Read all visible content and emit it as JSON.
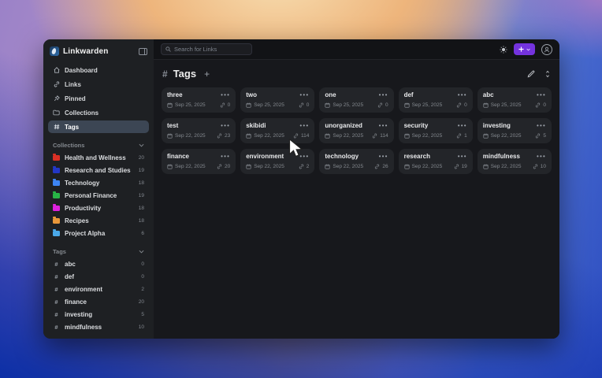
{
  "app": {
    "title": "Linkwarden"
  },
  "topbar": {
    "search_placeholder": "Search for Links"
  },
  "sidebar": {
    "nav": [
      {
        "label": "Dashboard"
      },
      {
        "label": "Links"
      },
      {
        "label": "Pinned"
      },
      {
        "label": "Collections"
      },
      {
        "label": "Tags"
      }
    ],
    "collections_header": "Collections",
    "collections": [
      {
        "label": "Health and Wellness",
        "count": "20",
        "color": "#d93025"
      },
      {
        "label": "Research and Studies",
        "count": "19",
        "color": "#2337c6"
      },
      {
        "label": "Technology",
        "count": "18",
        "color": "#3d85f4"
      },
      {
        "label": "Personal Finance",
        "count": "19",
        "color": "#28b446"
      },
      {
        "label": "Productivity",
        "count": "18",
        "color": "#de21de"
      },
      {
        "label": "Recipes",
        "count": "18",
        "color": "#e8973a"
      },
      {
        "label": "Project Alpha",
        "count": "6",
        "color": "#4aa8e8"
      }
    ],
    "tags_header": "Tags",
    "tags": [
      {
        "label": "abc",
        "count": "0"
      },
      {
        "label": "def",
        "count": "0"
      },
      {
        "label": "environment",
        "count": "2"
      },
      {
        "label": "finance",
        "count": "20"
      },
      {
        "label": "investing",
        "count": "5"
      },
      {
        "label": "mindfulness",
        "count": "10"
      }
    ]
  },
  "page": {
    "title": "Tags",
    "cards": [
      {
        "title": "three",
        "date": "Sep 25, 2025",
        "count": "0"
      },
      {
        "title": "two",
        "date": "Sep 25, 2025",
        "count": "0"
      },
      {
        "title": "one",
        "date": "Sep 25, 2025",
        "count": "0"
      },
      {
        "title": "def",
        "date": "Sep 25, 2025",
        "count": "0"
      },
      {
        "title": "abc",
        "date": "Sep 25, 2025",
        "count": "0"
      },
      {
        "title": "test",
        "date": "Sep 22, 2025",
        "count": "23"
      },
      {
        "title": "skibidi",
        "date": "Sep 22, 2025",
        "count": "114"
      },
      {
        "title": "unorganized",
        "date": "Sep 22, 2025",
        "count": "114"
      },
      {
        "title": "security",
        "date": "Sep 22, 2025",
        "count": "1"
      },
      {
        "title": "investing",
        "date": "Sep 22, 2025",
        "count": "5"
      },
      {
        "title": "finance",
        "date": "Sep 22, 2025",
        "count": "20"
      },
      {
        "title": "environment",
        "date": "Sep 22, 2025",
        "count": "2"
      },
      {
        "title": "technology",
        "date": "Sep 22, 2025",
        "count": "26"
      },
      {
        "title": "research",
        "date": "Sep 22, 2025",
        "count": "19"
      },
      {
        "title": "mindfulness",
        "date": "Sep 22, 2025",
        "count": "10"
      }
    ]
  }
}
